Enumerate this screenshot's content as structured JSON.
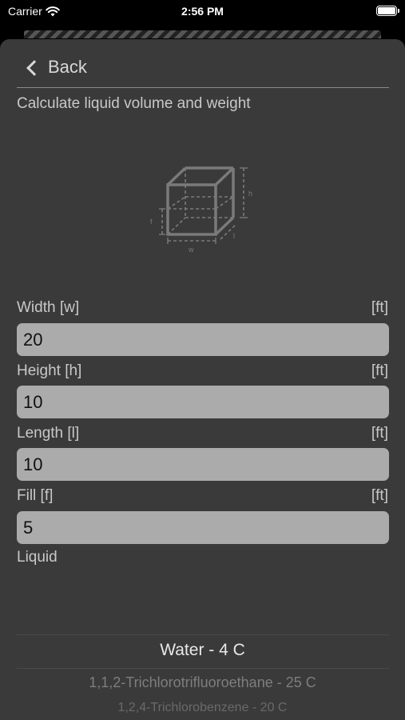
{
  "status_bar": {
    "carrier": "Carrier",
    "time": "2:56 PM"
  },
  "nav": {
    "back_label": "Back"
  },
  "page": {
    "subtitle": "Calculate liquid volume and weight"
  },
  "diagram": {
    "labels": {
      "h": "h",
      "f": "f",
      "l": "l",
      "w": "w"
    }
  },
  "fields": [
    {
      "label": "Width [w]",
      "unit": "[ft]",
      "value": "20"
    },
    {
      "label": "Height [h]",
      "unit": "[ft]",
      "value": "10"
    },
    {
      "label": "Length [l]",
      "unit": "[ft]",
      "value": "10"
    },
    {
      "label": "Fill [f]",
      "unit": "[ft]",
      "value": "5"
    }
  ],
  "liquid": {
    "label": "Liquid",
    "selected": "Water - 4 C",
    "options_below": [
      "1,1,2-Trichlorotrifluoroethane - 25 C",
      "1,2,4-Trichlorobenzene - 20 C"
    ]
  }
}
